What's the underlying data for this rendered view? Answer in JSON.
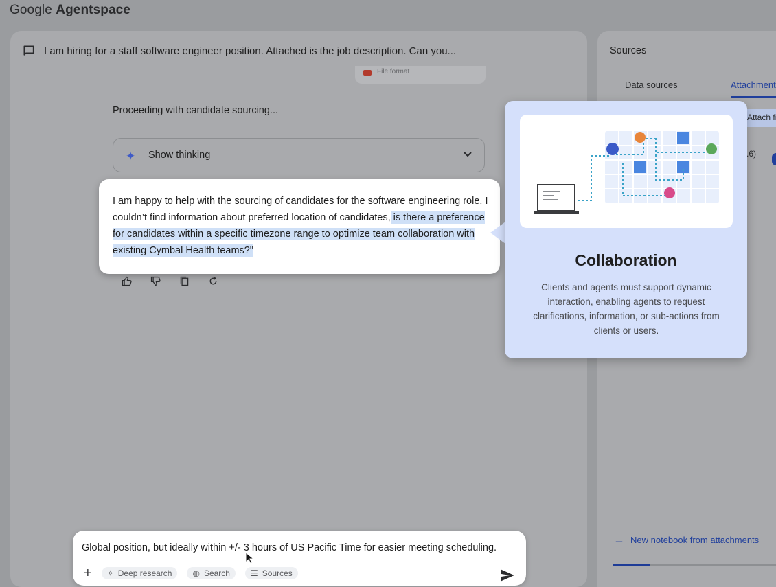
{
  "app": {
    "name_prefix": "Google",
    "name_main": "Agentspace"
  },
  "chat": {
    "header": "I am hiring for a staff software engineer position. Attached is the job description. Can you...",
    "file_format": "File format",
    "proceeding": "Proceeding with candidate sourcing...",
    "thinking_label": "Show thinking",
    "answer_plain": "I am happy to help with the sourcing of candidates for the software engineering role. I couldn’t find information about preferred location of candidates,",
    "answer_highlight": " is there a preference for candidates within a specific timezone range to optimize team collaboration with existing Cymbal Health teams?\""
  },
  "sources": {
    "title": "Sources",
    "tabs": [
      "Data sources",
      "Attachments"
    ],
    "attach_button": "Attach fi",
    "number_fragment": ".6)",
    "new_notebook": "New notebook from attachments",
    "progress_fraction": 0.23
  },
  "collab": {
    "title": "Collaboration",
    "body": "Clients and agents must support dynamic interaction, enabling agents to request clarifications, information, or sub-actions from clients or users."
  },
  "composer": {
    "text": "Global position, but ideally within +/- 3 hours of US Pacific Time for easier meeting scheduling.",
    "tools": [
      "Deep research",
      "Search",
      "Sources"
    ]
  }
}
